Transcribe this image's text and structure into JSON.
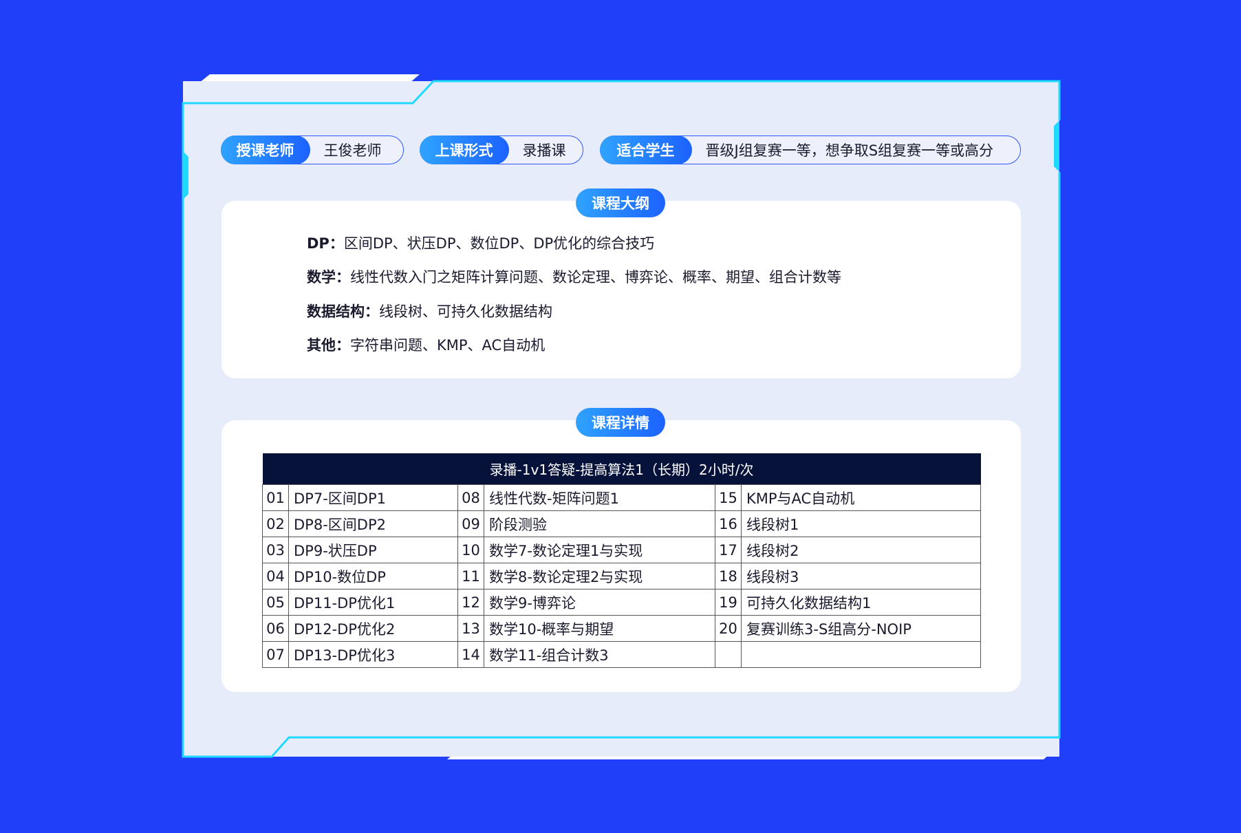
{
  "info": {
    "teacher": {
      "label": "授课老师",
      "value": "王俊老师"
    },
    "format": {
      "label": "上课形式",
      "value": "录播课"
    },
    "students": {
      "label": "适合学生",
      "value": "晋级J组复赛一等，想争取S组复赛一等或高分"
    }
  },
  "outline": {
    "title": "课程大纲",
    "items": [
      {
        "label": "DP：",
        "text": "区间DP、状压DP、数位DP、DP优化的综合技巧"
      },
      {
        "label": "数学：",
        "text": "线性代数入门之矩阵计算问题、数论定理、博弈论、概率、期望、组合计数等"
      },
      {
        "label": "数据结构：",
        "text": "线段树、可持久化数据结构"
      },
      {
        "label": "其他：",
        "text": "字符串问题、KMP、AC自动机"
      }
    ]
  },
  "details": {
    "title": "课程详情",
    "table_title": "录播-1v1答疑-提高算法1（长期）2小时/次",
    "rows": [
      [
        {
          "no": "01",
          "name": "DP7-区间DP1"
        },
        {
          "no": "08",
          "name": "线性代数-矩阵问题1"
        },
        {
          "no": "15",
          "name": "KMP与AC自动机"
        }
      ],
      [
        {
          "no": "02",
          "name": "DP8-区间DP2"
        },
        {
          "no": "09",
          "name": "阶段测验"
        },
        {
          "no": "16",
          "name": "线段树1"
        }
      ],
      [
        {
          "no": "03",
          "name": "DP9-状压DP"
        },
        {
          "no": "10",
          "name": "数学7-数论定理1与实现"
        },
        {
          "no": "17",
          "name": "线段树2"
        }
      ],
      [
        {
          "no": "04",
          "name": "DP10-数位DP"
        },
        {
          "no": "11",
          "name": "数学8-数论定理2与实现"
        },
        {
          "no": "18",
          "name": "线段树3"
        }
      ],
      [
        {
          "no": "05",
          "name": "DP11-DP优化1"
        },
        {
          "no": "12",
          "name": "数学9-博弈论"
        },
        {
          "no": "19",
          "name": "可持久化数据结构1"
        }
      ],
      [
        {
          "no": "06",
          "name": "DP12-DP优化2"
        },
        {
          "no": "13",
          "name": "数学10-概率与期望"
        },
        {
          "no": "20",
          "name": "复赛训练3-S组高分-NOIP"
        }
      ],
      [
        {
          "no": "07",
          "name": "DP13-DP优化3"
        },
        {
          "no": "14",
          "name": "数学11-组合计数3"
        },
        {
          "no": "",
          "name": ""
        }
      ]
    ]
  },
  "colors": {
    "background": "#1f40f8",
    "panel": "#e7ecfb",
    "accent": "#1c62ff",
    "cyan": "#20d9ff",
    "table_header": "#06123a"
  }
}
